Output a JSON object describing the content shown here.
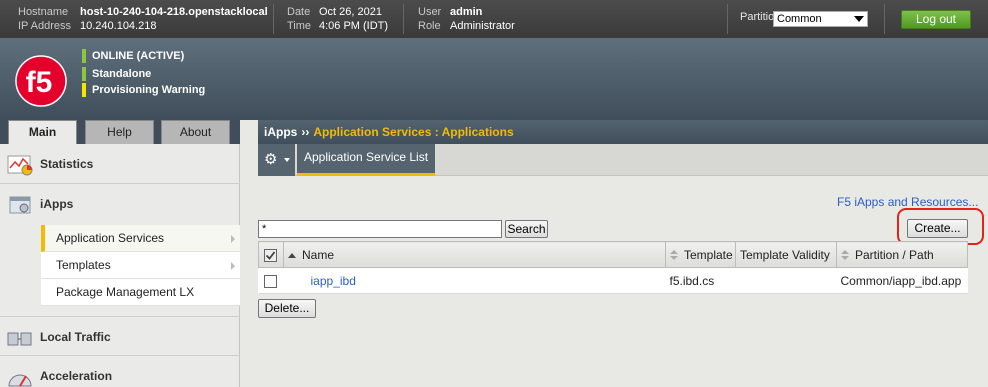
{
  "topbar": {
    "hostname_label": "Hostname",
    "hostname": "host-10-240-104-218.openstacklocal",
    "ip_label": "IP Address",
    "ip": "10.240.104.218",
    "date_label": "Date",
    "date": "Oct 26, 2021",
    "time_label": "Time",
    "time": "4:06 PM (IDT)",
    "user_label": "User",
    "user": "admin",
    "role_label": "Role",
    "role": "Administrator",
    "partition_label": "Partition:",
    "partition_value": "Common",
    "logout_label": "Log out"
  },
  "status": [
    {
      "text": "ONLINE (ACTIVE)",
      "color": "#8cc63f"
    },
    {
      "text": "Standalone",
      "color": "#8cc63f"
    },
    {
      "text": "Provisioning Warning",
      "color": "#f5e600"
    }
  ],
  "logo_text": "f5",
  "left_tabs": [
    "Main",
    "Help",
    "About"
  ],
  "nav": {
    "statistics": "Statistics",
    "iapps": "iApps",
    "iapps_items": [
      "Application Services",
      "Templates",
      "Package Management LX"
    ],
    "local_traffic": "Local Traffic",
    "acceleration": "Acceleration"
  },
  "breadcrumb": {
    "section": "iApps",
    "separator": "››",
    "page": "Application Services : Applications"
  },
  "subtab": "Application Service List",
  "resources_link": "F5 iApps and Resources...",
  "search": {
    "value": "*",
    "button": "Search"
  },
  "create_button": "Create...",
  "table": {
    "columns": [
      "Name",
      "Template",
      "Template Validity",
      "Partition / Path"
    ],
    "rows": [
      {
        "name": "iapp_ibd",
        "template": "f5.ibd.cs",
        "validity": "",
        "path": "Common/iapp_ibd.app"
      }
    ]
  },
  "delete_button": "Delete...",
  "colors": {
    "accent": "#f2bb07",
    "link": "#2b5ec9",
    "logout": "#5aa52b",
    "highlight": "#e2231a"
  }
}
